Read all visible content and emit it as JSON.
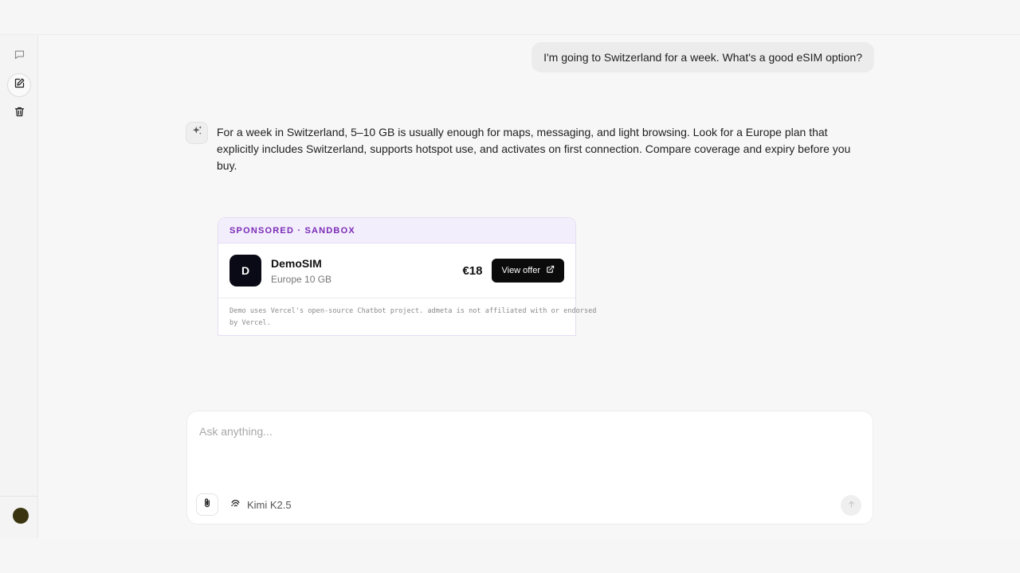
{
  "user_message": "I'm going to Switzerland for a week. What's a good eSIM option?",
  "assistant_message": "For a week in Switzerland, 5–10 GB is usually enough for maps, messaging, and light browsing. Look for a Europe plan that explicitly includes Switzerland, supports hotspot use, and activates on first connection. Compare coverage and expiry before you buy.",
  "ad": {
    "label": "SPONSORED · SANDBOX",
    "logo_letter": "D",
    "name": "DemoSIM",
    "plan": "Europe 10 GB",
    "price": "€18",
    "cta_label": "View offer",
    "disclaimer": "Demo uses Vercel's open-source Chatbot project. admeta is not affiliated with or endorsed by Vercel."
  },
  "composer": {
    "placeholder": "Ask anything...",
    "model_name": "Kimi K2.5"
  },
  "sidebar": {
    "icons": [
      "chat-bubble-icon",
      "new-chat-icon",
      "trash-icon"
    ]
  },
  "colors": {
    "accent_purple": "#7a2bb7",
    "ad_header_bg": "#f3eefb",
    "avatar": "#3a3510",
    "cta_bg": "#0b0b0b"
  }
}
